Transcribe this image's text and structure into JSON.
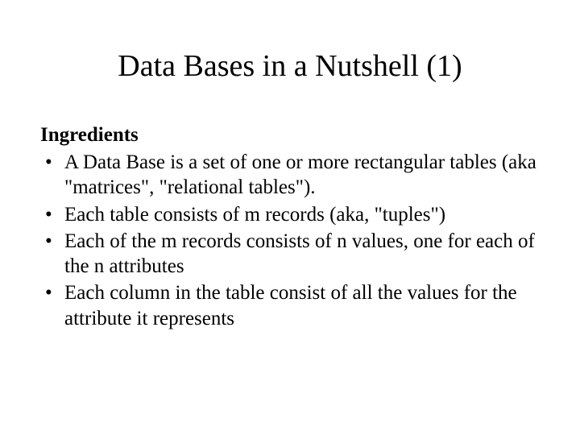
{
  "title": "Data Bases in a Nutshell (1)",
  "subtitle": "Ingredients",
  "bullets": [
    "A Data Base is a set of one or more rectangular tables (aka \"matrices\", \"relational tables\").",
    "Each table consists of m records (aka, \"tuples\")",
    "Each of the m records consists of n values, one for each of the n attributes",
    "Each column in the table consist of all the values for the attribute it represents"
  ]
}
